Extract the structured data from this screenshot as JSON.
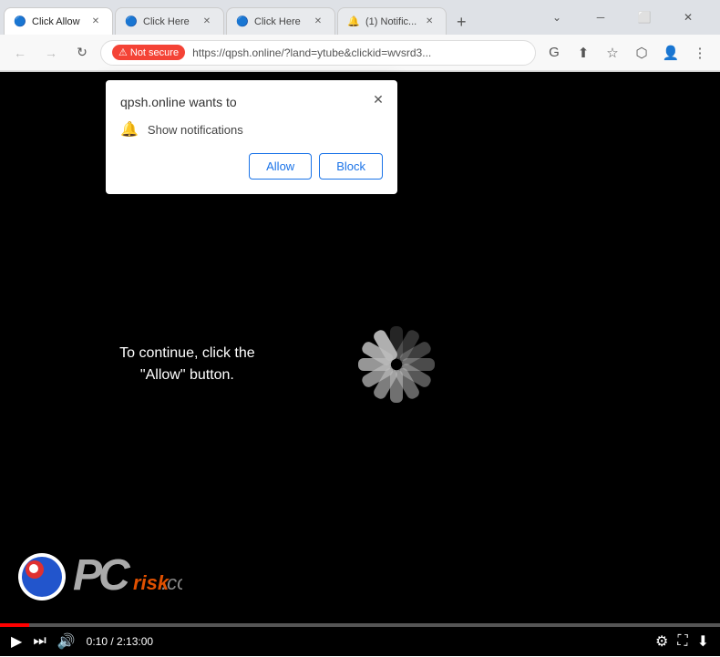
{
  "window": {
    "title": "Click Allow"
  },
  "titlebar": {
    "tabs": [
      {
        "id": "tab1",
        "label": "Click Allow",
        "active": true,
        "favicon": "🔵"
      },
      {
        "id": "tab2",
        "label": "Click Here",
        "active": false,
        "favicon": "🔵"
      },
      {
        "id": "tab3",
        "label": "Click Here",
        "active": false,
        "favicon": "🔵"
      },
      {
        "id": "tab4",
        "label": "(1) Notific...",
        "active": false,
        "favicon": "🔔"
      }
    ],
    "new_tab_label": "+",
    "minimize_label": "─",
    "restore_label": "⬜",
    "close_label": "✕",
    "chevron_icon": "⌄"
  },
  "addressbar": {
    "back_tooltip": "Back",
    "forward_tooltip": "Forward",
    "reload_tooltip": "Reload",
    "not_secure_label": "Not secure",
    "url": "https://qpsh.online/?land=ytube&clickid=wvsrd3...",
    "search_icon": "🔍",
    "share_icon": "⬆",
    "bookmark_icon": "☆",
    "extensions_icon": "⬡",
    "profile_icon": "👤",
    "menu_icon": "⋮"
  },
  "notification_popup": {
    "title": "qpsh.online wants to",
    "close_label": "✕",
    "notification_row": "Show notifications",
    "allow_button": "Allow",
    "block_button": "Block"
  },
  "main_content": {
    "overlay_text": "To continue, click the\n\"Allow\" button.",
    "spinner_segments": 12
  },
  "video_controls": {
    "play_icon": "▶",
    "next_icon": "⏭",
    "volume_icon": "🔊",
    "time_current": "0:10",
    "time_total": "2:13:00",
    "time_separator": " / ",
    "settings_icon": "⚙",
    "fullscreen_icon": "⛶",
    "download_icon": "⬇",
    "progress_percent": 4
  },
  "watermark": {
    "text": "risk.com",
    "pc_text": "PC",
    "italic_text": "r"
  }
}
